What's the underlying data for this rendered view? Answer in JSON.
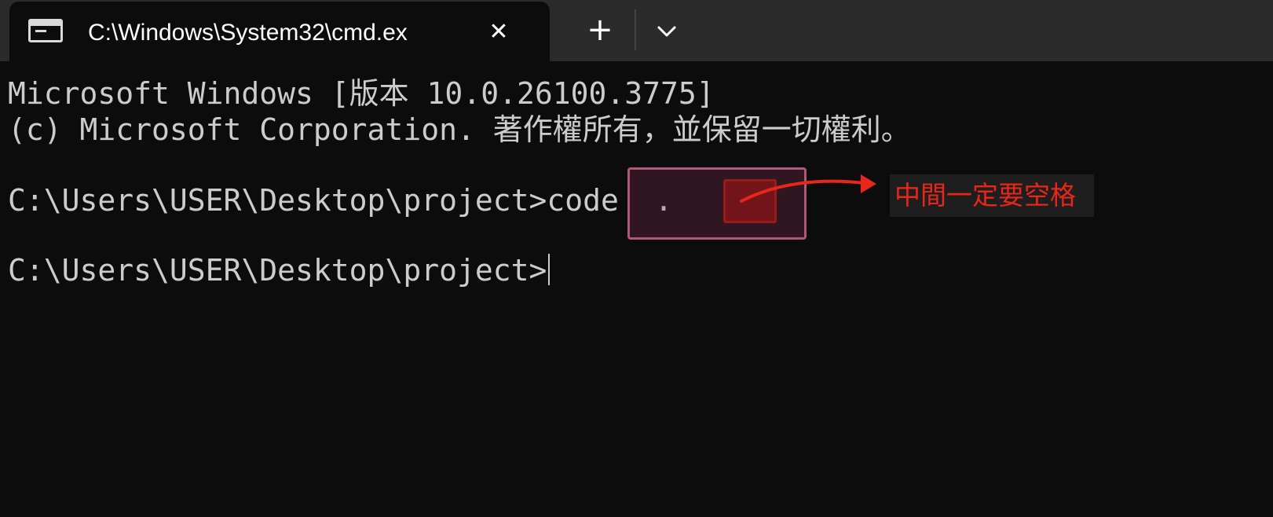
{
  "tab": {
    "title": "C:\\Windows\\System32\\cmd.ex",
    "icon": "console-window-icon",
    "close_glyph": "✕"
  },
  "toolbar": {
    "new_tab_glyph": "+",
    "dropdown_icon": "chevron-down-icon"
  },
  "console": {
    "line1": "Microsoft Windows [版本 10.0.26100.3775]",
    "line2": "(c) Microsoft Corporation. 著作權所有，並保留一切權利。",
    "line4_prompt": "C:\\Users\\USER\\Desktop\\project>",
    "line4_command": "code  .",
    "line6_prompt": "C:\\Users\\USER\\Desktop\\project>"
  },
  "annotation": {
    "note": "中間一定要空格",
    "color": "#e8261a"
  },
  "colors": {
    "background": "#0c0c0c",
    "text": "#cccccc",
    "tabbar": "#2b2b2b"
  }
}
